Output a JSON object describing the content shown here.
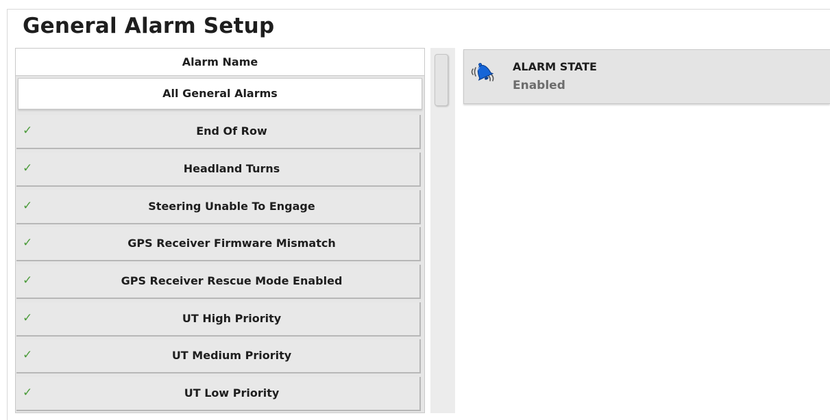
{
  "page": {
    "title": "General Alarm Setup"
  },
  "alarm_list": {
    "column_header": "Alarm Name",
    "all_alarms_label": "All General Alarms",
    "items": [
      {
        "label": "End Of Row",
        "checked": true
      },
      {
        "label": "Headland Turns",
        "checked": true
      },
      {
        "label": "Steering Unable To Engage",
        "checked": true
      },
      {
        "label": "GPS Receiver Firmware Mismatch",
        "checked": true
      },
      {
        "label": "GPS Receiver Rescue Mode Enabled",
        "checked": true
      },
      {
        "label": "UT High Priority",
        "checked": true
      },
      {
        "label": "UT Medium Priority",
        "checked": true
      },
      {
        "label": "UT Low Priority",
        "checked": true
      }
    ],
    "check_glyph": "✓",
    "check_color": "#4b9b3a"
  },
  "alarm_state": {
    "icon": "alarm-bell-icon",
    "title": "ALARM STATE",
    "value": "Enabled",
    "icon_color": "#1565d8"
  }
}
